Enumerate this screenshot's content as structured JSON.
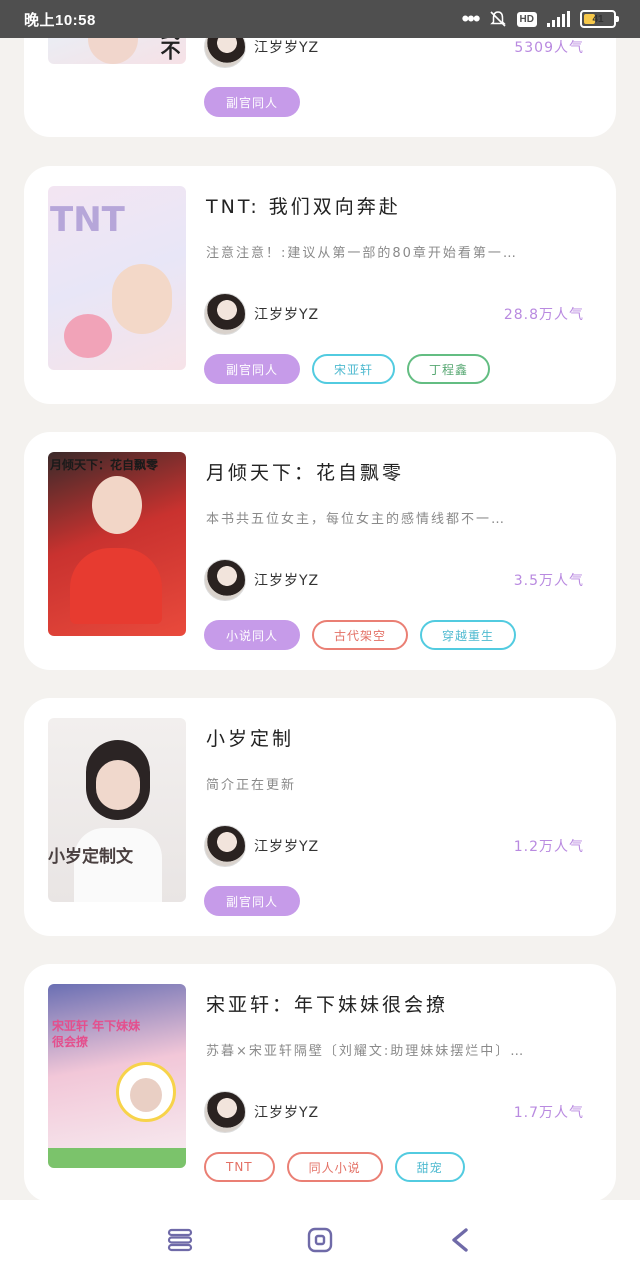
{
  "status_bar": {
    "time": "晚上10:58",
    "dots": "•••",
    "hd": "HD",
    "battery": "41",
    "battery_level": 0.41
  },
  "books": [
    {
      "title": "",
      "description": "",
      "author": "江岁岁YZ",
      "popularity": "5309人气",
      "cover_text": "美式不苦",
      "tags": [
        {
          "label": "副官同人",
          "style": "filled"
        }
      ]
    },
    {
      "title": "TNT: 我们双向奔赴",
      "description": "注意注意！:建议从第一部的80章开始看第一…",
      "author": "江岁岁YZ",
      "popularity": "28.8万人气",
      "cover_text": "TNT",
      "tags": [
        {
          "label": "副官同人",
          "style": "filled"
        },
        {
          "label": "宋亚轩",
          "style": "cyan"
        },
        {
          "label": "丁程鑫",
          "style": "green"
        }
      ]
    },
    {
      "title": "月倾天下：花自飘零",
      "description": "本书共五位女主，每位女主的感情线都不一…",
      "author": "江岁岁YZ",
      "popularity": "3.5万人气",
      "cover_text": "月倾天下：花自飘零",
      "tags": [
        {
          "label": "小说同人",
          "style": "filled"
        },
        {
          "label": "古代架空",
          "style": "coral"
        },
        {
          "label": "穿越重生",
          "style": "cyan"
        }
      ]
    },
    {
      "title": "小岁定制",
      "description": "简介正在更新",
      "author": "江岁岁YZ",
      "popularity": "1.2万人气",
      "cover_text": "小岁定制文",
      "tags": [
        {
          "label": "副官同人",
          "style": "filled"
        }
      ]
    },
    {
      "title": "宋亚轩：年下妹妹很会撩",
      "description": "苏暮×宋亚轩隔壁〔刘耀文:助理妹妹摆烂中〕…",
      "author": "江岁岁YZ",
      "popularity": "1.7万人气",
      "cover_text": "宋亚轩 年下妹妹很会撩",
      "tags": [
        {
          "label": "TNT",
          "style": "coral"
        },
        {
          "label": "同人小说",
          "style": "coral"
        },
        {
          "label": "甜宠",
          "style": "cyan"
        }
      ]
    }
  ],
  "nav": {
    "menu_icon": "menu-icon",
    "home_icon": "home-icon",
    "back_icon": "back-icon"
  }
}
